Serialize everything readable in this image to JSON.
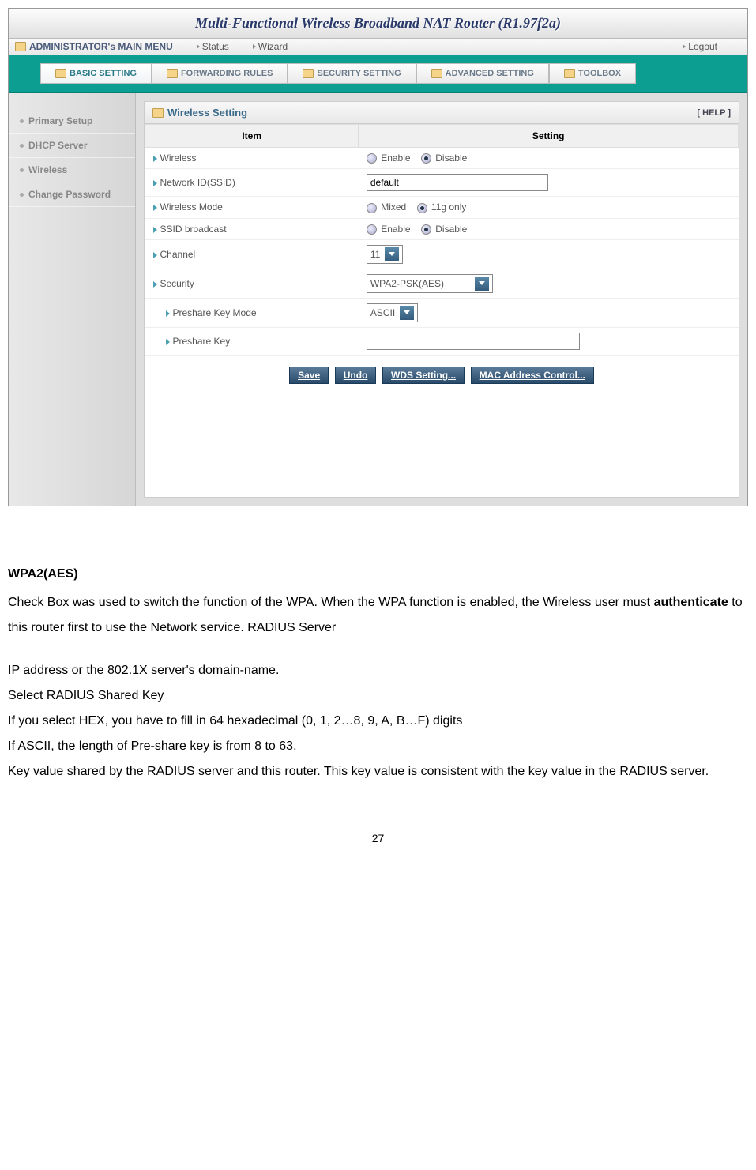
{
  "titlebar": {
    "title": "Multi-Functional Wireless Broadband NAT Router (R1.97f2a)"
  },
  "menubar": {
    "admin": "ADMINISTRATOR's MAIN MENU",
    "status": "Status",
    "wizard": "Wizard",
    "logout": "Logout"
  },
  "tabs": {
    "basic": "BASIC SETTING",
    "forwarding": "FORWARDING RULES",
    "security": "SECURITY SETTING",
    "advanced": "ADVANCED SETTING",
    "toolbox": "TOOLBOX"
  },
  "sidebar": {
    "items": [
      {
        "label": "Primary Setup"
      },
      {
        "label": "DHCP Server"
      },
      {
        "label": "Wireless"
      },
      {
        "label": "Change Password"
      }
    ]
  },
  "panel": {
    "title": "Wireless Setting",
    "help": "[ HELP ]",
    "th_item": "Item",
    "th_setting": "Setting",
    "rows": {
      "wireless": "Wireless",
      "wireless_enable": "Enable",
      "wireless_disable": "Disable",
      "ssid_label": "Network ID(SSID)",
      "ssid_value": "default",
      "mode_label": "Wireless Mode",
      "mode_mixed": "Mixed",
      "mode_11g": "11g only",
      "broadcast_label": "SSID broadcast",
      "broadcast_enable": "Enable",
      "broadcast_disable": "Disable",
      "channel_label": "Channel",
      "channel_value": "11",
      "security_label": "Security",
      "security_value": "WPA2-PSK(AES)",
      "preshare_mode_label": "Preshare Key Mode",
      "preshare_mode_value": "ASCII",
      "preshare_key_label": "Preshare Key",
      "preshare_key_value": ""
    },
    "buttons": {
      "save": "Save",
      "undo": "Undo",
      "wds": "WDS Setting...",
      "mac": "MAC Address Control..."
    }
  },
  "doc": {
    "heading": "WPA2(AES)",
    "p1a": "Check Box was used to switch the function of the WPA. When the WPA function is enabled, the Wireless user must ",
    "p1b": "authenticate",
    "p1c": " to this router first to use the Network service. RADIUS Server",
    "p2": "IP address or the 802.1X server's domain-name.",
    "p3": "Select RADIUS Shared Key",
    "p4": "If you select HEX, you have to fill in 64 hexadecimal (0, 1, 2…8, 9, A, B…F) digits",
    "p5": "If ASCII, the length of Pre-share key is from 8 to 63.",
    "p6": "Key value shared by the RADIUS server and this router. This key value is consistent with the key value in the RADIUS server.",
    "page": "27"
  }
}
